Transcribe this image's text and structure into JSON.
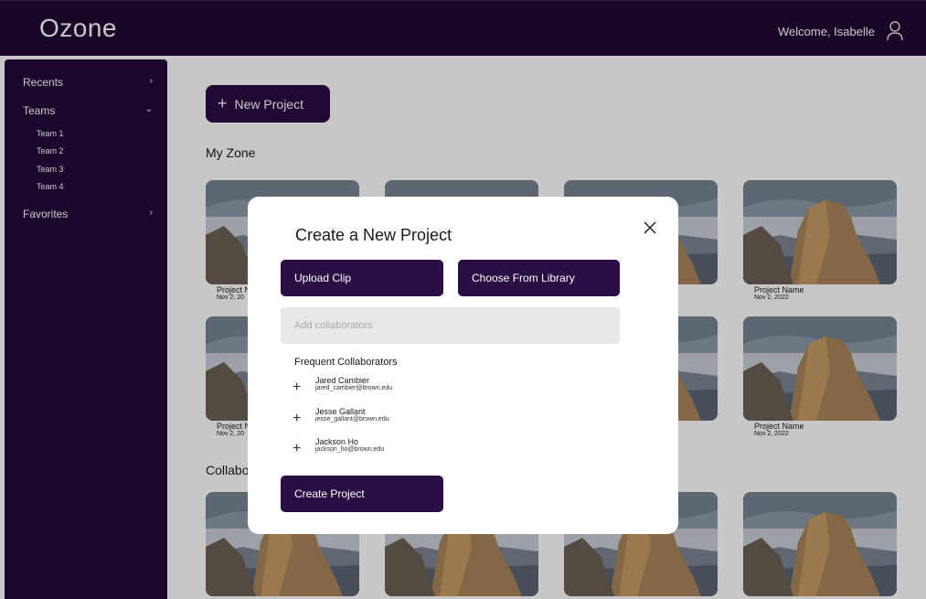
{
  "app": {
    "logo": "Ozone",
    "welcome": "Welcome, Isabelle"
  },
  "sidebar": {
    "items": [
      {
        "label": "Recents",
        "chevron": "›"
      },
      {
        "label": "Teams",
        "chevron": "⌄"
      },
      {
        "label": "Favorites",
        "chevron": "›"
      }
    ],
    "teams": [
      "Team 1",
      "Team 2",
      "Team 3",
      "Team 4"
    ]
  },
  "main": {
    "new_project_label": "New Project",
    "my_zone_title": "My Zone",
    "collab_title": "Collabo",
    "project_name": "Project Name",
    "project_name_clipped": "Project N",
    "project_date": "Nov 2, 2022",
    "project_date_clipped": "Nov 2, 20"
  },
  "modal": {
    "title": "Create a New Project",
    "upload_label": "Upload Clip",
    "library_label": "Choose From Library",
    "collab_placeholder": "Add collaborators",
    "frequent_title": "Frequent Collaborators",
    "collaborators": [
      {
        "name": "Jared Cambier",
        "email": "jared_cambier@brown.edu"
      },
      {
        "name": "Jesse Gallant",
        "email": "jesse_gallant@brown.edu"
      },
      {
        "name": "Jackson Ho",
        "email": "jackson_ho@brown.edu"
      }
    ],
    "create_label": "Create Project"
  },
  "colors": {
    "primary": "#2a0d44",
    "header": "#1f0a33",
    "sidebar": "#230a3a"
  },
  "icons": {
    "user": "user-icon",
    "close": "close-icon",
    "plus": "plus-icon",
    "chevron": "chevron-icon"
  }
}
